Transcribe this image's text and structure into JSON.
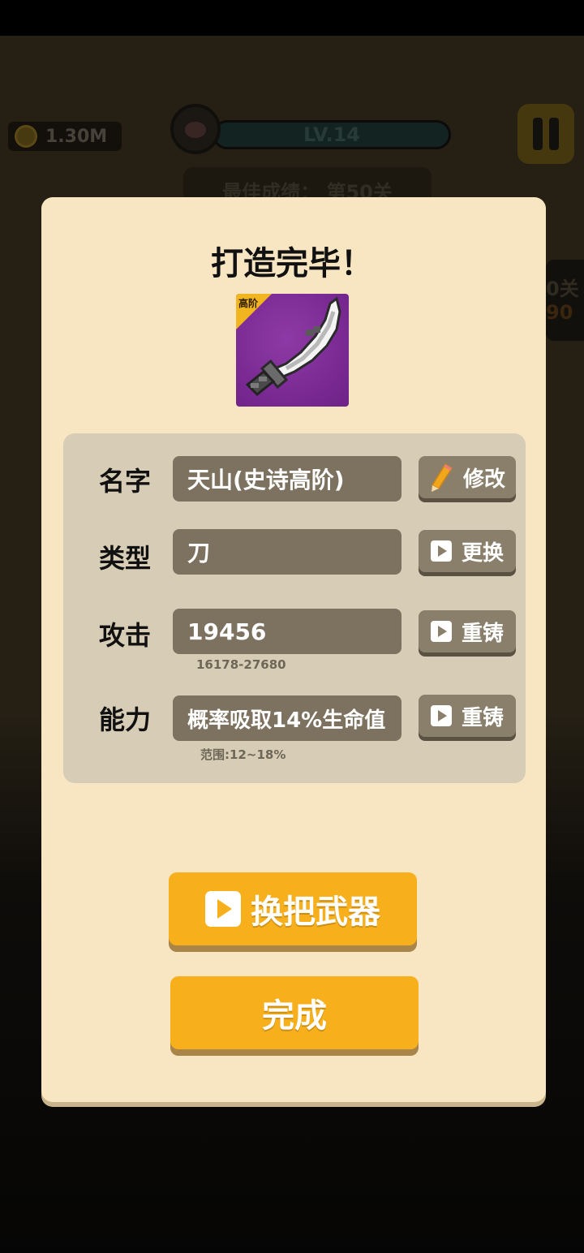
{
  "hud": {
    "coins": "1.30M",
    "level": "LV.14",
    "best_score": "最佳成绩： 第50关",
    "side_panel_text": "0关",
    "side_panel_num": "90"
  },
  "dialog": {
    "title": "打造完毕！",
    "weapon": {
      "rank_tag": "高阶"
    },
    "rows": {
      "name": {
        "label": "名字",
        "value": "天山(史诗高阶)",
        "button": "修改"
      },
      "type": {
        "label": "类型",
        "value": "刀",
        "button": "更换"
      },
      "attack": {
        "label": "攻击",
        "value": "19456",
        "range": "16178-27680",
        "button": "重铸"
      },
      "ability": {
        "label": "能力",
        "value": "概率吸取14%生命值",
        "range": "范围:12~18%",
        "button": "重铸"
      }
    },
    "swap_weapon_button": "换把武器",
    "done_button": "完成"
  },
  "colors": {
    "dialog_bg": "#f8e6c2",
    "accent_button": "#f7b01c",
    "card_purple": "#7b2a94"
  }
}
